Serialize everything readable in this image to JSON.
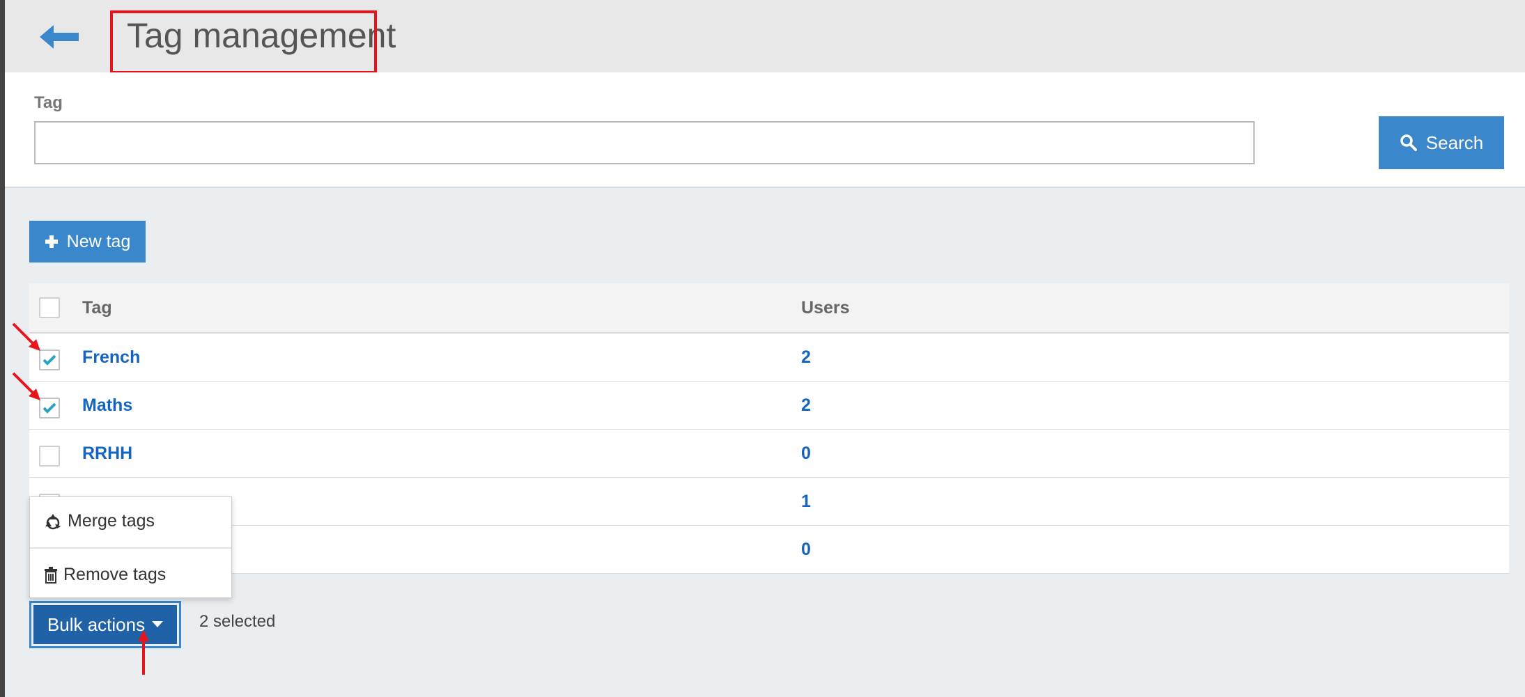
{
  "header": {
    "title": "Tag management"
  },
  "search": {
    "label": "Tag",
    "value": "",
    "button_label": "Search"
  },
  "toolbar": {
    "new_tag_label": "New tag"
  },
  "table": {
    "columns": [
      "Tag",
      "Users"
    ],
    "rows": [
      {
        "tag": "French",
        "users": "2",
        "checked": true
      },
      {
        "tag": "Maths",
        "users": "2",
        "checked": true
      },
      {
        "tag": "RRHH",
        "users": "0",
        "checked": false
      },
      {
        "tag": "",
        "users": "1",
        "checked": false
      },
      {
        "tag": "",
        "users": "0",
        "checked": false
      }
    ]
  },
  "bulk": {
    "menu": [
      {
        "label": "Merge tags",
        "icon": "recycle-icon"
      },
      {
        "label": "Remove tags",
        "icon": "trash-icon"
      }
    ],
    "button_label": "Bulk actions",
    "selected_text": "2 selected"
  },
  "colors": {
    "accent": "#3a87cc",
    "link": "#1565c0",
    "annotation": "#e8141b"
  }
}
